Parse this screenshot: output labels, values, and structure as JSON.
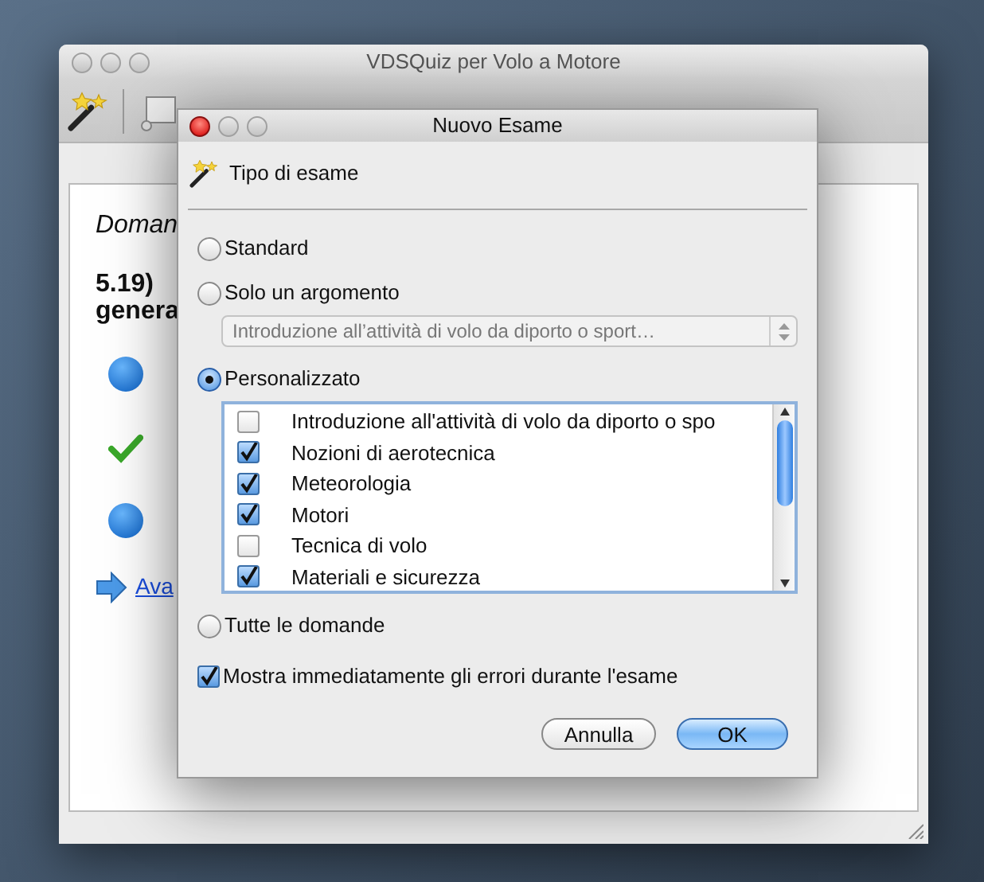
{
  "main_window": {
    "title": "VDSQuiz per Volo a Motore",
    "question_label": "Doman",
    "question_lines": [
      "5.19)",
      "genera"
    ],
    "answers": [
      {
        "kind": "circle"
      },
      {
        "kind": "check"
      },
      {
        "kind": "circle"
      }
    ],
    "next_link": "Ava"
  },
  "dialog": {
    "title": "Nuovo Esame",
    "header": "Tipo di esame",
    "options": [
      {
        "label": "Standard",
        "selected": false
      },
      {
        "label": "Solo un argomento",
        "selected": false,
        "kind": "popup",
        "popup_value": "Introduzione all’attività di volo da diporto o sport…"
      },
      {
        "label": "Personalizzato",
        "selected": true,
        "kind": "list"
      },
      {
        "label": "Tutte le domande",
        "selected": false
      }
    ],
    "topics": [
      {
        "label": "Introduzione all'attività di volo da diporto o spo",
        "checked": false
      },
      {
        "label": "Nozioni di aerotecnica",
        "checked": true
      },
      {
        "label": "Meteorologia",
        "checked": true
      },
      {
        "label": "Motori",
        "checked": true
      },
      {
        "label": "Tecnica di volo",
        "checked": false
      },
      {
        "label": "Materiali e sicurezza",
        "checked": true
      }
    ],
    "show_errors": {
      "label": "Mostra immediatamente gli errori durante l'esame",
      "checked": true
    },
    "buttons": [
      {
        "label": "Annulla",
        "kind": "default"
      },
      {
        "label": "OK",
        "kind": "primary"
      }
    ]
  }
}
